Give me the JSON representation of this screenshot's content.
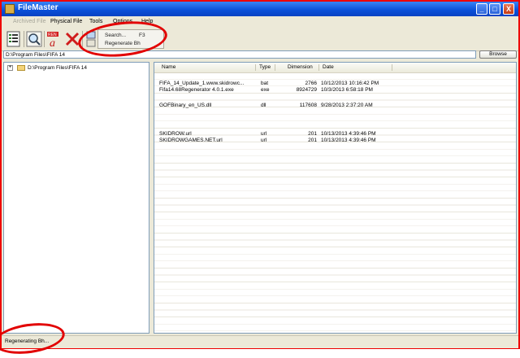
{
  "window": {
    "title": "FileMaster",
    "controls": {
      "minimize": "_",
      "maximize": "□",
      "close": "X"
    }
  },
  "menu": {
    "items": [
      {
        "label": "Archived File",
        "disabled": true
      },
      {
        "label": "Physical File",
        "disabled": false
      },
      {
        "label": "Tools",
        "disabled": false
      },
      {
        "label": "Options",
        "disabled": false
      },
      {
        "label": "Help",
        "disabled": false
      }
    ]
  },
  "toolbar": {
    "icons": [
      "list-icon",
      "magnifier-icon",
      "rename-icon",
      "delete-icon",
      "small-tool-icon"
    ],
    "rename_badge": "REN",
    "dropdown": {
      "search_label": "Search...",
      "search_shortcut": "F3",
      "regenerate_label": "Regenerate Bh"
    }
  },
  "path": {
    "value": "D:\\Program Files\\FIFA 14",
    "browse_label": "Browse"
  },
  "tree": {
    "nodes": [
      {
        "label": "D:\\Program Files\\FIFA 14",
        "expander": "+"
      }
    ]
  },
  "files": {
    "columns": [
      "Name",
      "Type",
      "Dimension",
      "Date"
    ],
    "rows": [
      {
        "name": "FIFA_14_Update_1.www.skidrowc...",
        "type": "bat",
        "dimension": "2766",
        "date": "10/12/2013 10:16:42 PM"
      },
      {
        "name": "Fifa14.68Regenerator 4.0.1.exe",
        "type": "exe",
        "dimension": "8924729",
        "date": "10/3/2013 6:58:18 PM"
      },
      {
        "name": "GOFBinary_en_US.dll",
        "type": "dll",
        "dimension": "117608",
        "date": "9/28/2013 2:37:20 AM"
      },
      {
        "name": "SKIDROW.url",
        "type": "url",
        "dimension": "201",
        "date": "10/13/2013 4:39:46 PM"
      },
      {
        "name": "SKIDROWGAMES.NET.url",
        "type": "url",
        "dimension": "201",
        "date": "10/13/2013 4:39:46 PM"
      }
    ]
  },
  "status": {
    "text": "Regenerating Bh..."
  },
  "colors": {
    "annotation": "#e20000",
    "titlebar": "#0a4fd8"
  }
}
